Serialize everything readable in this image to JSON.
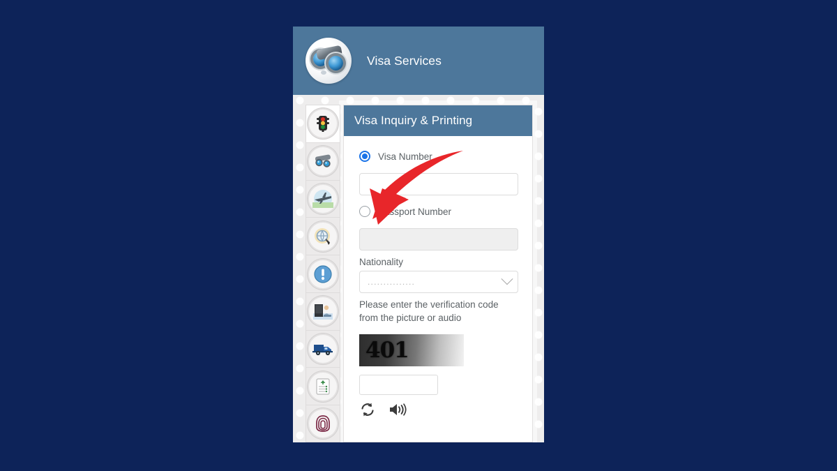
{
  "theme": {
    "page_background": "#0d2359",
    "header_blue": "#4d779b",
    "panel_title_blue": "#4d779b",
    "radio_accent": "#1a73e8",
    "arrow_red": "#e8262a",
    "body_texture": "#eeeded",
    "text_gray": "#5b6165"
  },
  "header": {
    "title": "Visa Services",
    "logo_icon": "binoculars-globe-logo"
  },
  "sidebar": {
    "items": [
      {
        "icon": "traffic-light-icon",
        "active": true
      },
      {
        "icon": "binoculars-globe-icon",
        "active": false
      },
      {
        "icon": "airplane-icon",
        "active": false
      },
      {
        "icon": "magnifier-globe-icon",
        "active": false
      },
      {
        "icon": "exclamation-mark-icon",
        "active": false
      },
      {
        "icon": "person-at-desk-icon",
        "active": false
      },
      {
        "icon": "delivery-truck-icon",
        "active": false
      },
      {
        "icon": "document-list-icon",
        "active": false
      },
      {
        "icon": "fingerprint-icon",
        "active": false
      }
    ]
  },
  "panel": {
    "title": "Visa Inquiry & Printing",
    "search_mode": {
      "options": [
        {
          "label": "Visa Number",
          "selected": true
        },
        {
          "label": "Passport Number",
          "selected": false
        }
      ]
    },
    "visa_number_input": {
      "value": "",
      "placeholder": ""
    },
    "passport_number_input": {
      "value": "",
      "placeholder": "",
      "disabled": true
    },
    "nationality": {
      "label": "Nationality",
      "selected_value": "...............",
      "chevron_icon": "chevron-down-icon"
    },
    "captcha": {
      "helper_text": "Please enter the verification code from the picture or audio",
      "image_code": "401",
      "input_value": "",
      "refresh_icon": "refresh-icon",
      "audio_icon": "speaker-icon"
    }
  },
  "annotation": {
    "arrow_icon": "red-arrow-pointing-to-passport-number",
    "color": "#e8262a"
  }
}
